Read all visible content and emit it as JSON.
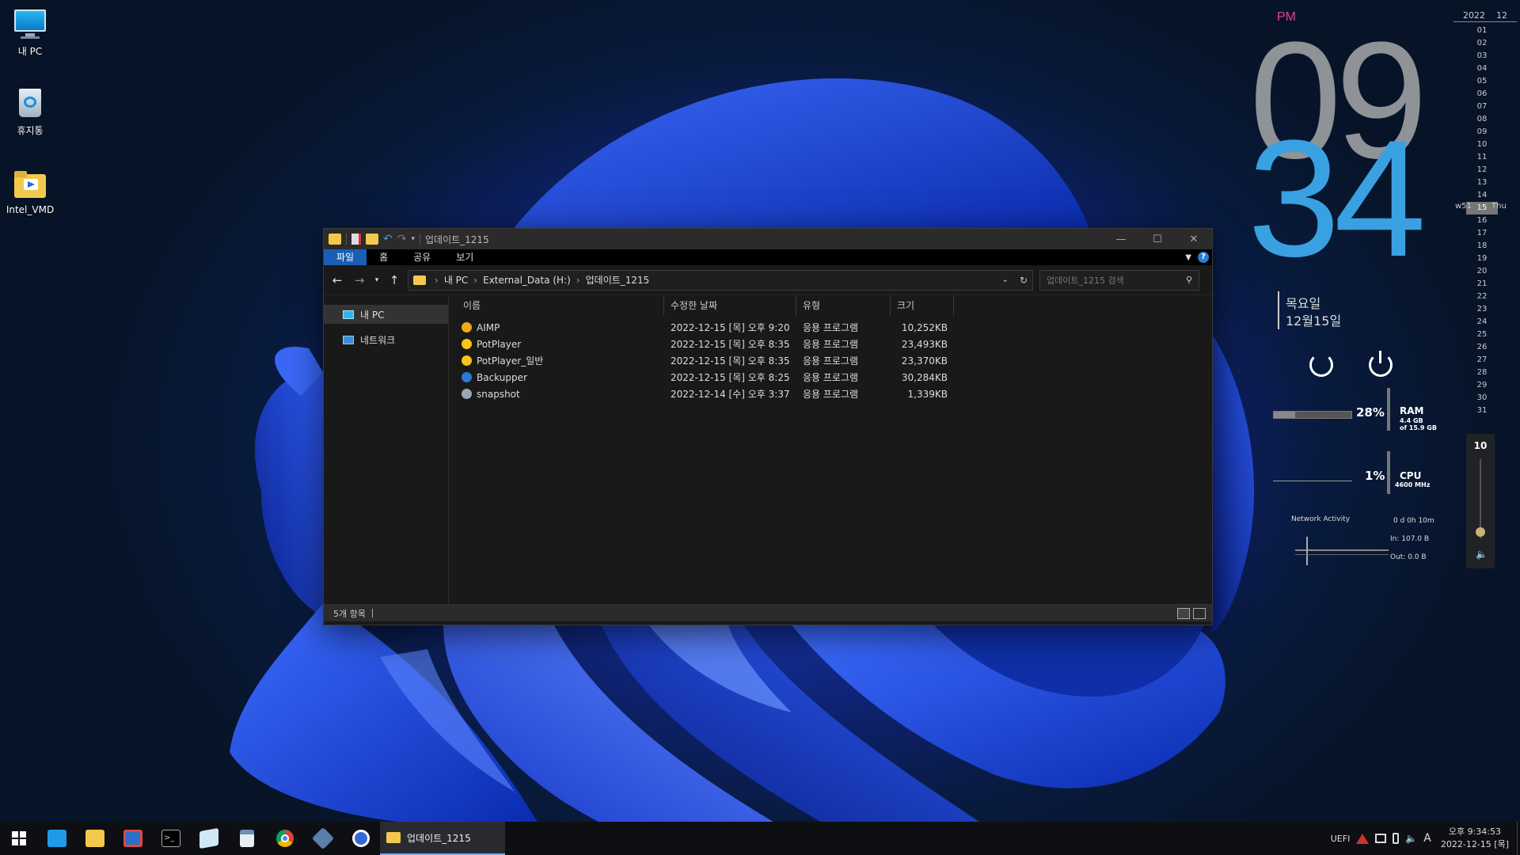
{
  "desktop_icons": [
    {
      "label": "내 PC",
      "icon": "monitor-icon"
    },
    {
      "label": "휴지통",
      "icon": "recycle-bin-icon"
    },
    {
      "label": "Intel_VMD",
      "icon": "folder-icon"
    }
  ],
  "clock": {
    "ampm": "PM",
    "hour": "09",
    "minute": "34",
    "day_name": "목요일",
    "date": "12월15일"
  },
  "calendar": {
    "year": "2022",
    "month": "12",
    "days": [
      "01",
      "02",
      "03",
      "04",
      "05",
      "06",
      "07",
      "08",
      "09",
      "10",
      "11",
      "12",
      "13",
      "14",
      "15",
      "16",
      "17",
      "18",
      "19",
      "20",
      "21",
      "22",
      "23",
      "24",
      "25",
      "26",
      "27",
      "28",
      "29",
      "30",
      "31"
    ],
    "week": "w51",
    "today": "15",
    "weekday": "Thu"
  },
  "system": {
    "ram_percent": "28%",
    "ram_label": "RAM",
    "ram_used": "4.4 GB",
    "ram_total": "of 15.9 GB",
    "cpu_percent": "1%",
    "cpu_label": "CPU",
    "cpu_freq": "4600 MHz",
    "network_label": "Network Activity",
    "uptime": "0 d 0h 10m",
    "net_in": "In: 107.0 B",
    "net_out": "Out: 0.0 B",
    "volume": "10"
  },
  "explorer": {
    "title": "업데이트_1215",
    "ribbon_tabs": [
      "파일",
      "홈",
      "공유",
      "보기"
    ],
    "breadcrumb": [
      "내 PC",
      "External_Data (H:)",
      "업데이트_1215"
    ],
    "search_placeholder": "업데이트_1215 검색",
    "nav": [
      {
        "label": "내 PC",
        "icon": "monitor-icon"
      },
      {
        "label": "네트워크",
        "icon": "network-icon"
      }
    ],
    "columns": [
      "이름",
      "수정한 날짜",
      "유형",
      "크기"
    ],
    "files": [
      {
        "name": "AIMP",
        "date": "2022-12-15 [목] 오후 9:20",
        "type": "응용 프로그램",
        "size": "10,252KB",
        "icon": "aimp-icon",
        "color": "#f0a81c"
      },
      {
        "name": "PotPlayer",
        "date": "2022-12-15 [목] 오후 8:35",
        "type": "응용 프로그램",
        "size": "23,493KB",
        "icon": "potplayer-icon",
        "color": "#f5c518"
      },
      {
        "name": "PotPlayer_일반",
        "date": "2022-12-15 [목] 오후 8:35",
        "type": "응용 프로그램",
        "size": "23,370KB",
        "icon": "potplayer-icon",
        "color": "#f5c518"
      },
      {
        "name": "Backupper",
        "date": "2022-12-15 [목] 오후 8:25",
        "type": "응용 프로그램",
        "size": "30,284KB",
        "icon": "backupper-icon",
        "color": "#2b7bd6"
      },
      {
        "name": "snapshot",
        "date": "2022-12-14 [수] 오후 3:37",
        "type": "응용 프로그램",
        "size": "1,339KB",
        "icon": "snapshot-icon",
        "color": "#9aa7b8"
      }
    ],
    "status": "5개 항목"
  },
  "taskbar": {
    "apps": [
      {
        "name": "start-button",
        "icon": "windows-logo-icon"
      },
      {
        "name": "taskbar-desktop",
        "icon": "monitor-icon"
      },
      {
        "name": "taskbar-explorer",
        "icon": "folder-icon"
      },
      {
        "name": "taskbar-save",
        "icon": "floppy-icon"
      },
      {
        "name": "taskbar-terminal",
        "icon": "terminal-icon"
      },
      {
        "name": "taskbar-notepad",
        "icon": "notepad-icon"
      },
      {
        "name": "taskbar-calculator",
        "icon": "calculator-icon"
      },
      {
        "name": "taskbar-chrome",
        "icon": "chrome-icon"
      },
      {
        "name": "taskbar-tool",
        "icon": "gear-icon"
      },
      {
        "name": "taskbar-app",
        "icon": "app-icon"
      }
    ],
    "active_window": "업데이트_1215",
    "uefi": "UEFI",
    "ime": "A",
    "time": "오후 9:34:53",
    "date": "2022-12-15 [목]"
  }
}
